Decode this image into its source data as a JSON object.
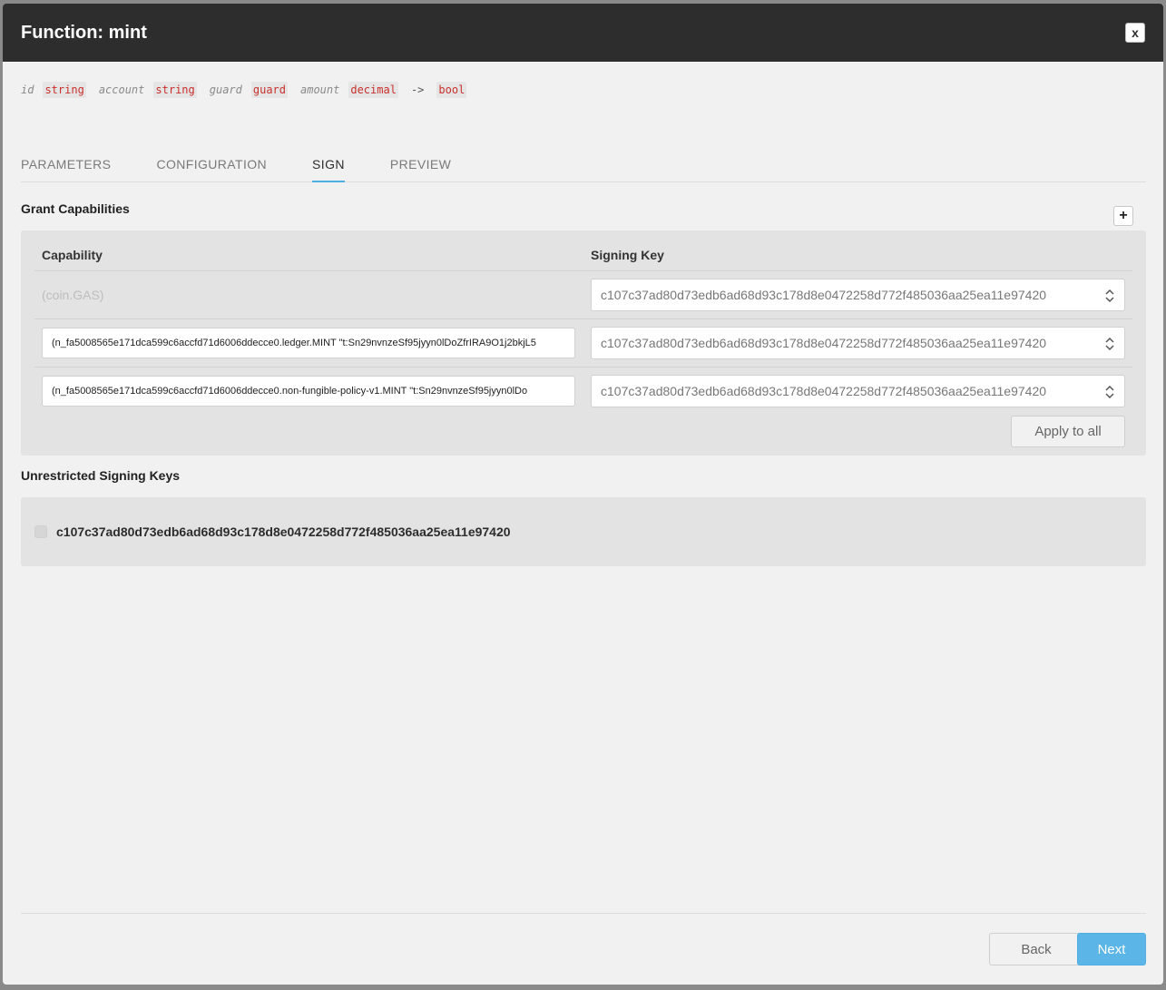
{
  "header": {
    "title": "Function: mint",
    "close_label": "x"
  },
  "signature": {
    "params": [
      {
        "name": "id",
        "type": "string"
      },
      {
        "name": "account",
        "type": "string"
      },
      {
        "name": "guard",
        "type": "guard"
      },
      {
        "name": "amount",
        "type": "decimal"
      }
    ],
    "arrow": "->",
    "return_type": "bool"
  },
  "tabs": [
    {
      "label": "PARAMETERS",
      "active": false
    },
    {
      "label": "CONFIGURATION",
      "active": false
    },
    {
      "label": "SIGN",
      "active": true
    },
    {
      "label": "PREVIEW",
      "active": false
    }
  ],
  "grant": {
    "title": "Grant Capabilities",
    "add_label": "+",
    "col_capability": "Capability",
    "col_signing_key": "Signing Key",
    "rows": [
      {
        "capability": "(coin.GAS)",
        "editable": false,
        "key": "c107c37ad80d73edb6ad68d93c178d8e0472258d772f485036aa25ea11e97420"
      },
      {
        "capability": "(n_fa5008565e171dca599c6accfd71d6006ddecce0.ledger.MINT \"t:Sn29nvnzeSf95jyyn0lDoZfrIRA9O1j2bkjL5",
        "editable": true,
        "key": "c107c37ad80d73edb6ad68d93c178d8e0472258d772f485036aa25ea11e97420"
      },
      {
        "capability": "(n_fa5008565e171dca599c6accfd71d6006ddecce0.non-fungible-policy-v1.MINT \"t:Sn29nvnzeSf95jyyn0lDo",
        "editable": true,
        "key": "c107c37ad80d73edb6ad68d93c178d8e0472258d772f485036aa25ea11e97420"
      }
    ],
    "apply_label": "Apply to all"
  },
  "unrestricted": {
    "title": "Unrestricted Signing Keys",
    "keys": [
      {
        "key": "c107c37ad80d73edb6ad68d93c178d8e0472258d772f485036aa25ea11e97420",
        "checked": false
      }
    ]
  },
  "footer": {
    "back_label": "Back",
    "next_label": "Next"
  },
  "colors": {
    "header_bg": "#2d2d2d",
    "accent": "#5bb5e6",
    "type_red": "#c9302c"
  }
}
